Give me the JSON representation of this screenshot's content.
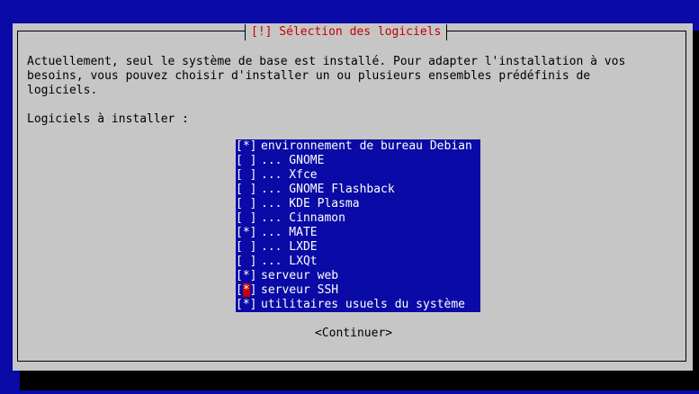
{
  "colors": {
    "background": "#0a0aa6",
    "dialog": "#c6c6c6",
    "title": "#c40000",
    "list_background": "#0a0aa6",
    "list_text": "#ffffff",
    "cursor": "#c40000"
  },
  "dialog": {
    "title": "[!] Sélection des logiciels",
    "intro_lines": [
      "Actuellement, seul le système de base est installé. Pour adapter l'installation à vos",
      "besoins, vous pouvez choisir d'installer un ou plusieurs ensembles prédéfinis de",
      "logiciels."
    ],
    "prompt": "Logiciels à installer :",
    "continue_label": "<Continuer>"
  },
  "software": [
    {
      "checked": true,
      "label": "environnement de bureau Debian"
    },
    {
      "checked": false,
      "label": "... GNOME"
    },
    {
      "checked": false,
      "label": "... Xfce"
    },
    {
      "checked": false,
      "label": "... GNOME Flashback"
    },
    {
      "checked": false,
      "label": "... KDE Plasma"
    },
    {
      "checked": false,
      "label": "... Cinnamon"
    },
    {
      "checked": true,
      "label": "... MATE"
    },
    {
      "checked": false,
      "label": "... LXDE"
    },
    {
      "checked": false,
      "label": "... LXQt"
    },
    {
      "checked": true,
      "label": "serveur web"
    },
    {
      "checked": true,
      "label": "serveur SSH",
      "cursor": true
    },
    {
      "checked": true,
      "label": "utilitaires usuels du système"
    }
  ]
}
